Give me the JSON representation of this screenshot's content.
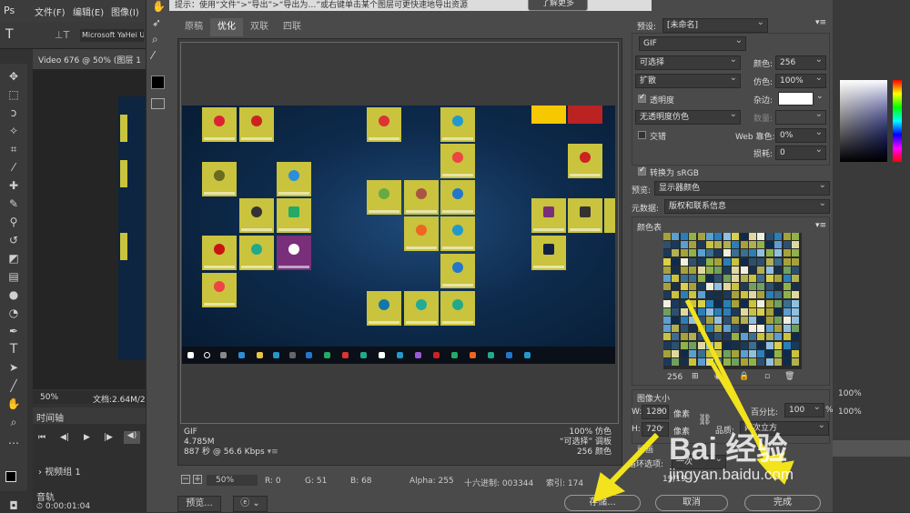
{
  "hint": {
    "text": "提示：使用“文件”>“导出”>“导出为…”或右键单击某个图层可更快速地导出资源",
    "learn_more": "了解更多"
  },
  "ps": {
    "menu": [
      "文件(F)",
      "编辑(E)",
      "图像(I)"
    ],
    "font_name": "Microsoft YaHei U",
    "doc_tab": "Video 676 @ 50% (图层 1",
    "zoom": "50%",
    "doc_size": "文档:2.64M/2",
    "timeline_tab": "时间轴",
    "video_group": "视频组 1",
    "audio_track": "音轨",
    "timecode": "0:00:01:04",
    "right_pcts": [
      "100%",
      "100%"
    ]
  },
  "tabs": [
    "原稿",
    "优化",
    "双联",
    "四联"
  ],
  "active_tab": "优化",
  "preview_info_left": [
    "GIF",
    "4.785M",
    "887 秒 @ 56.6 Kbps"
  ],
  "preview_info_right": [
    "100% 仿色",
    "“可选择” 调板",
    "256 颜色"
  ],
  "bottom": {
    "zoom": "50%",
    "r": "R: 0",
    "g": "G: 51",
    "b": "B: 68",
    "alpha": "Alpha: 255",
    "hex": "十六进制: 003344",
    "index": "索引: 174",
    "preview": "预览...",
    "frames": "19/19"
  },
  "settings": {
    "preset_label": "预设:",
    "preset_value": "[未命名]",
    "format": "GIF",
    "reduction": "可选择",
    "dither_algo": "扩散",
    "transparency": "透明度",
    "transparency_checked": true,
    "matte_dither": "无透明度仿色",
    "interlace": "交错",
    "interlace_checked": false,
    "colors_label": "颜色:",
    "colors_value": "256",
    "dither_label": "仿色:",
    "dither_value": "100%",
    "matte_label": "杂边:",
    "amount_label": "数量:",
    "web_snap_label": "Web 靠色:",
    "web_snap_value": "0%",
    "lossy_label": "损耗:",
    "lossy_value": "0",
    "convert_srgb": "转换为 sRGB",
    "convert_checked": true,
    "preview_label": "预览:",
    "preview_value": "显示器颜色",
    "metadata_label": "元数据:",
    "metadata_value": "版权和联系信息",
    "color_table_label": "颜色表",
    "color_count": "256",
    "image_size_label": "图像大小",
    "w_label": "W:",
    "w_value": "1280",
    "h_label": "H:",
    "h_value": "720",
    "px": "像素",
    "percent_label": "百分比:",
    "percent_value": "100",
    "percent_sign": "%",
    "quality_label": "品质:",
    "quality_value": "两次立方",
    "animation_label": "动画",
    "loop_label": "循环选项:",
    "loop_value": "一次"
  },
  "buttons": {
    "save": "存储...",
    "cancel": "取消",
    "done": "完成"
  },
  "watermark": {
    "text": "Bai 经验",
    "url": "jingyan.baidu.com"
  },
  "colors": {
    "arrow": "#f2e31c",
    "tile": "#c9c33e",
    "dialog_bg": "#4a4a4a"
  }
}
